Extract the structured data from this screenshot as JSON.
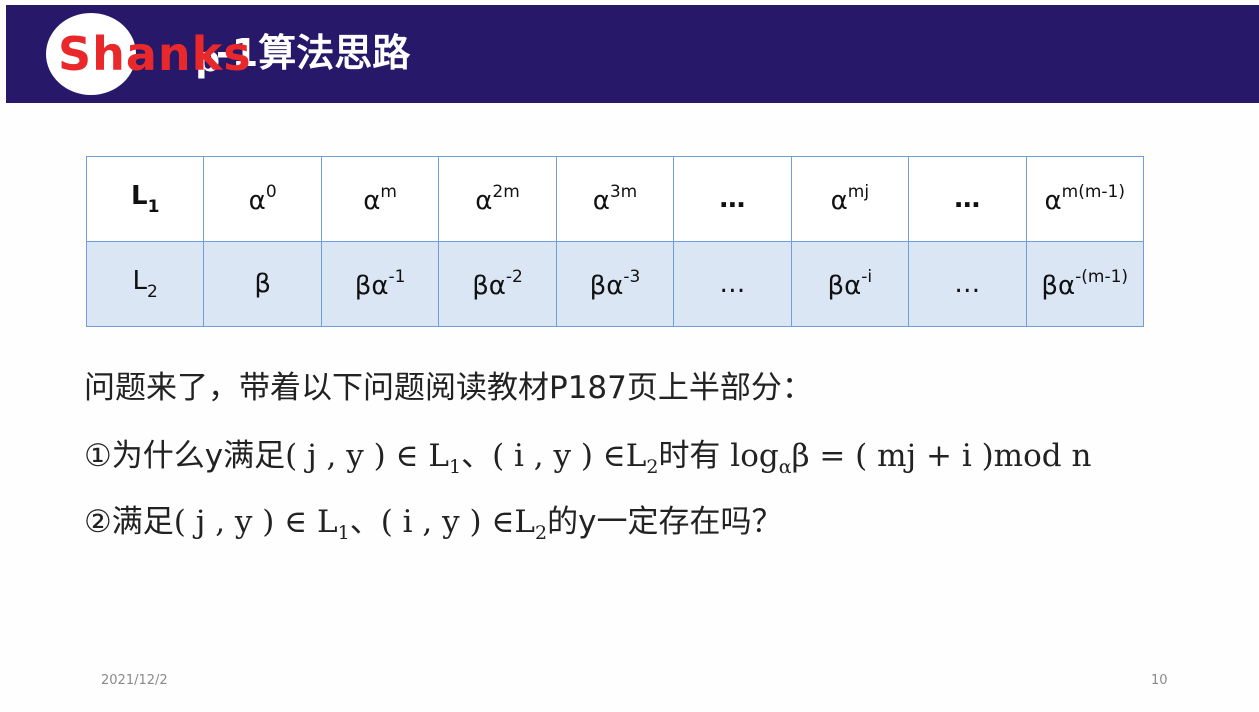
{
  "header": {
    "logo_watermark": "Shanks",
    "title_rho": "ρ",
    "title_rest": "-1算法思路"
  },
  "table": {
    "row1": [
      {
        "base": "L",
        "sub": "1",
        "bold": true
      },
      {
        "base": "α",
        "sup": "0"
      },
      {
        "base": "α",
        "sup": "m"
      },
      {
        "base": "α",
        "sup": "2m"
      },
      {
        "base": "α",
        "sup": "3m"
      },
      {
        "base": "…",
        "bold": true
      },
      {
        "base": "α",
        "sup": "mj"
      },
      {
        "base": "…",
        "bold": true
      },
      {
        "base": "α",
        "sup": "m(m-1)"
      }
    ],
    "row2": [
      {
        "base": "L",
        "sub": "2"
      },
      {
        "base": "β"
      },
      {
        "base": "βα",
        "sup": "-1"
      },
      {
        "base": "βα",
        "sup": "-2"
      },
      {
        "base": "βα",
        "sup": "-3"
      },
      {
        "base": "…"
      },
      {
        "base": "βα",
        "sup": "-i"
      },
      {
        "base": "…"
      },
      {
        "base": "βα",
        "sup": "-(m-1)"
      }
    ]
  },
  "body": {
    "line1": "问题来了，带着以下问题阅读教材P187页上半部分：",
    "line2": {
      "a": "①为什么y满足",
      "b": "( j , y ) ∈ L",
      "b_sub": "1",
      "c": "、",
      "d": "( i , y ) ∈L",
      "d_sub": "2",
      "e": "时有 ",
      "f": "log",
      "f_sub": "α",
      "g": "β = ( mj + i )mod n"
    },
    "line3": {
      "a": "②满足",
      "b": "( j , y ) ∈ L",
      "b_sub": "1",
      "c": "、",
      "d": "( i , y ) ∈L",
      "d_sub": "2",
      "e": "的y一定存在吗？"
    }
  },
  "footer": {
    "date": "2021/12/2",
    "page_number": "10"
  }
}
